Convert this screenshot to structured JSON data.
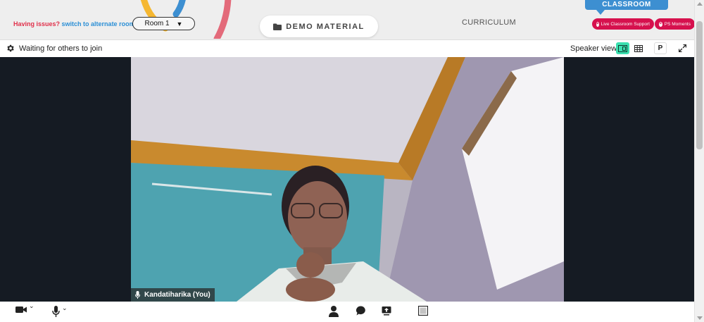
{
  "header": {
    "issues_prefix": "Having issues?",
    "issues_link": "switch to alternate room",
    "room_value": "Room 1",
    "demo_label": "DEMO MATERIAL",
    "curriculum_label": "CURRICULUM",
    "classroom_label": "CLASSROOM",
    "support_label": "Live Classroom Support",
    "moments_label": "PS Moments"
  },
  "meeting": {
    "status": "Waiting for others to join",
    "view_label": "Speaker view",
    "presenter_badge": "P"
  },
  "video": {
    "participant_name": "Kandatiharika (You)"
  },
  "colors": {
    "accent_red": "#d6114e",
    "accent_blue": "#3d8fd1",
    "active_view": "#3be0b0",
    "video_bg": "#151b23"
  },
  "icons": {
    "folder": "folder-icon",
    "settings": "gear-icon",
    "camera": "video-camera-icon",
    "mic": "microphone-icon",
    "participants": "person-icon",
    "chat": "chat-bubble-icon",
    "share": "share-screen-icon",
    "whiteboard": "whiteboard-icon"
  }
}
